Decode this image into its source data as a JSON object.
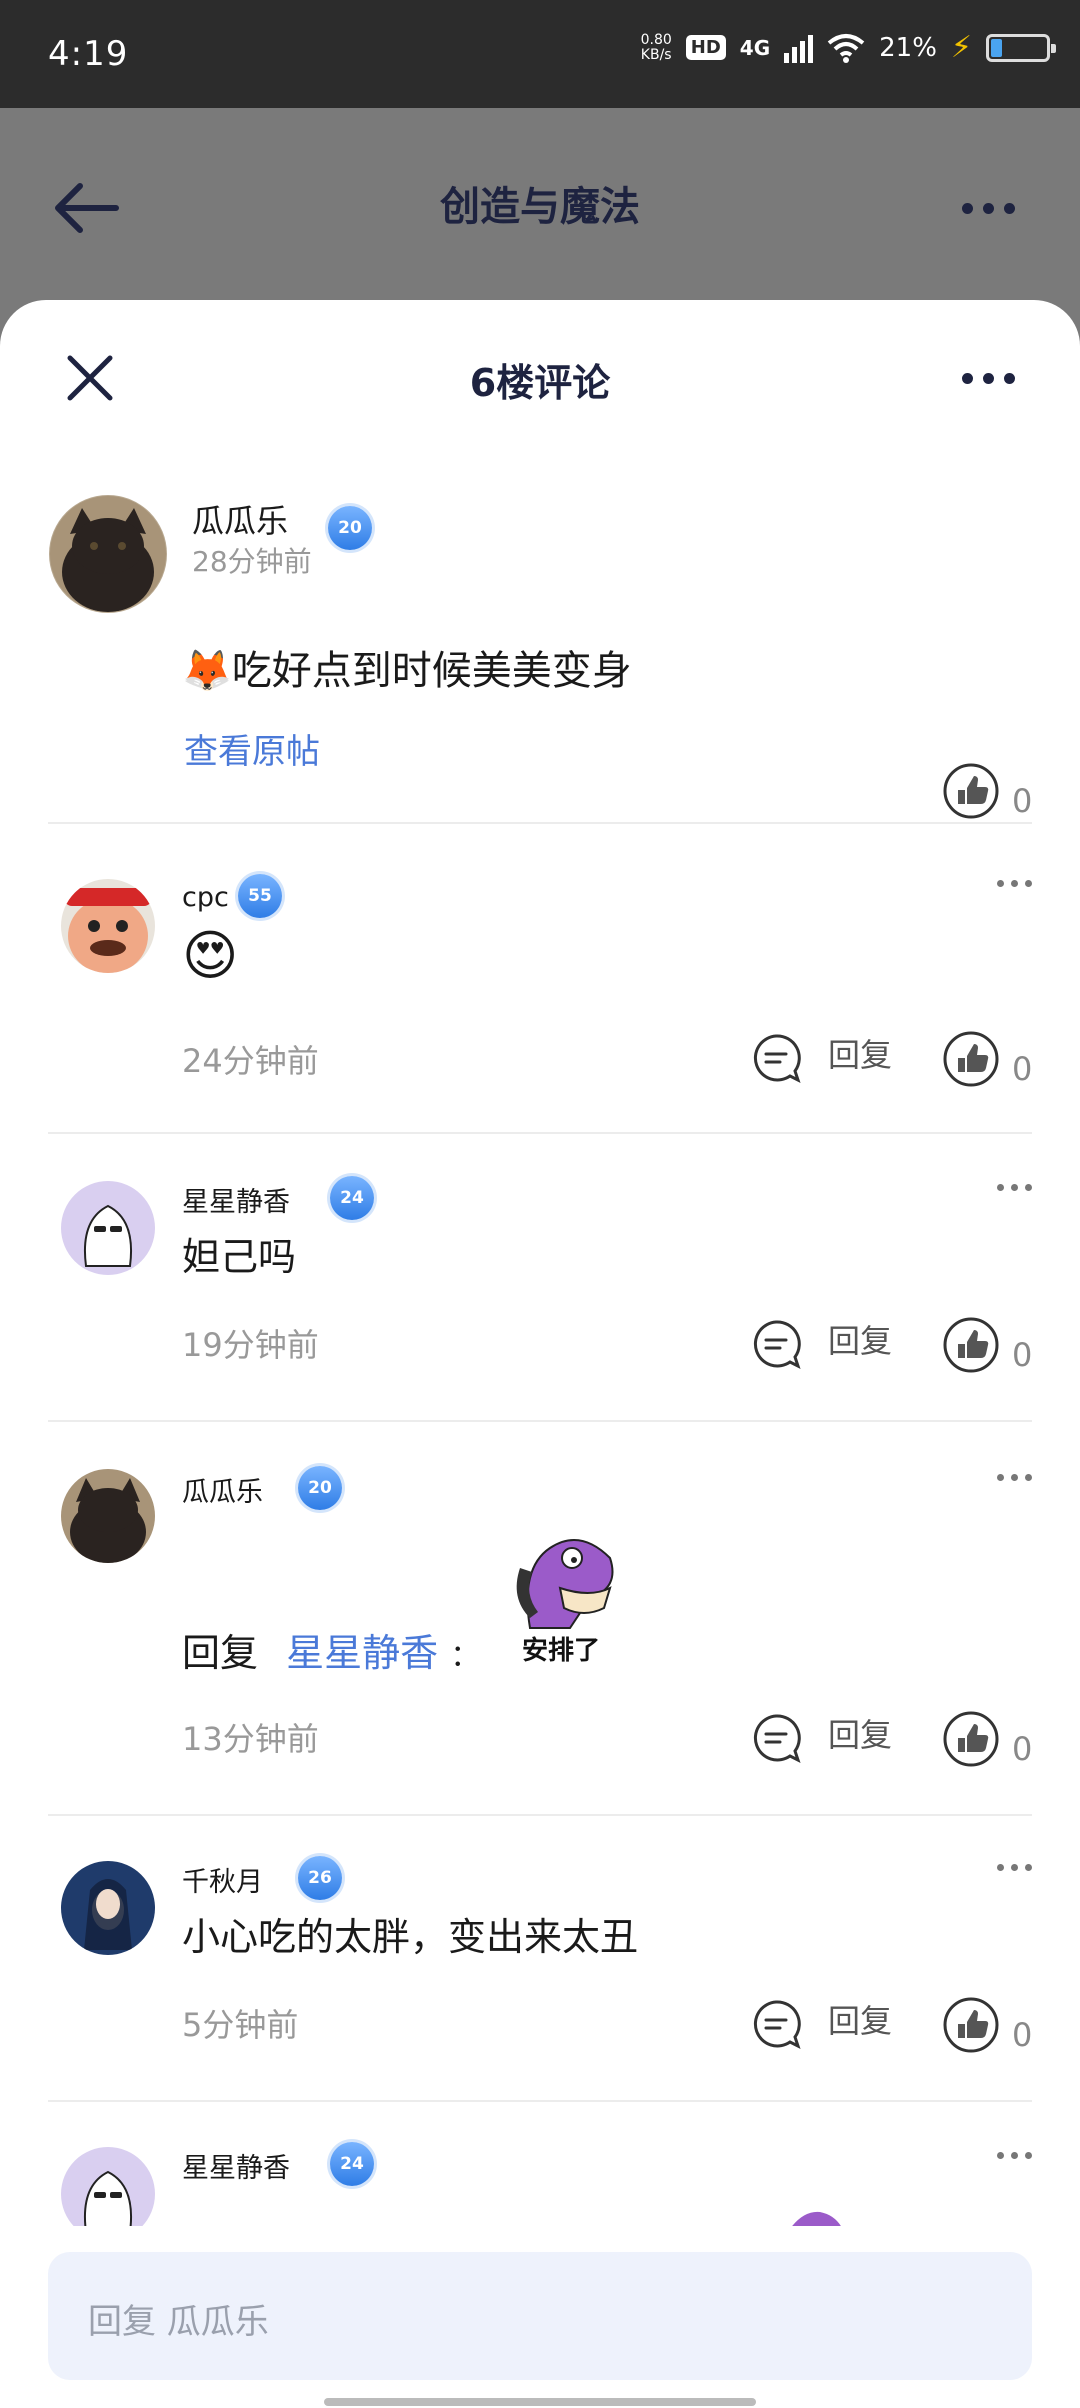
{
  "status_bar": {
    "time": "4:19",
    "net_speed": "0.80",
    "net_unit": "KB/s",
    "hd": "HD",
    "network": "4G",
    "battery": "21%",
    "battery_level": 0.21
  },
  "app_bar": {
    "title": "创造与魔法"
  },
  "sheet": {
    "title": "6楼评论"
  },
  "post": {
    "user": "瓜瓜乐",
    "level": "20",
    "time": "28分钟前",
    "text": "🦊吃好点到时候美美变身",
    "view_original": "查看原帖",
    "likes": "0"
  },
  "comments": [
    {
      "user": "cpc",
      "level": "55",
      "text": "😍",
      "time": "24分钟前",
      "reply_label": "回复",
      "likes": "0"
    },
    {
      "user": "星星静香",
      "level": "24",
      "text": "妲己吗",
      "time": "19分钟前",
      "reply_label": "回复",
      "likes": "0"
    },
    {
      "user": "瓜瓜乐",
      "level": "20",
      "reply_prefix": "回复",
      "reply_to": "星星静香",
      "colon": "：",
      "sticker_text": "安排了",
      "time": "13分钟前",
      "reply_label": "回复",
      "likes": "0"
    },
    {
      "user": "千秋月",
      "level": "26",
      "text": "小心吃的太胖，变出来太丑",
      "time": "5分钟前",
      "reply_label": "回复",
      "likes": "0"
    },
    {
      "user": "星星静香",
      "level": "24"
    }
  ],
  "input": {
    "placeholder": "回复 瓜瓜乐"
  }
}
